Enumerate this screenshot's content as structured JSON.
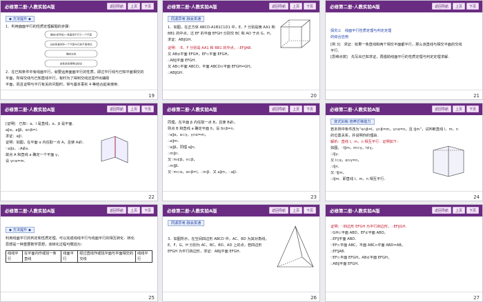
{
  "header": {
    "title": "必修第二册·人教实验A版",
    "btn_nav": "返回导航",
    "btn_prev": "上页",
    "btn_next": "下页"
  },
  "colors": {
    "header": "#6a2c82",
    "accent_red": "#c0182b",
    "accent_blue": "#1b3fa6"
  },
  "slides": [
    {
      "num": "19",
      "tip": "方法提升",
      "lines": [
        "1．利用面面平行的性质定理解题的步骤：",
        "2．在已知条件中有线面平行，就要运用面面平行的性质，即过平行线与已知平面相交的",
        "平面，所得交线与已知直线平行，有时为了得到交线还需作出辅助",
        "平面，而且证明与平行有关的问题时，常与基本事实 4 等结合起来使用．"
      ],
      "flow": [
        "确定(或寻找)一条直线平行于一个平面",
        "过这条直线作一个平面与已知平面相交",
        "确定交线",
        "由性质定理得出结论"
      ]
    },
    {
      "num": "20",
      "badge": "同源异考",
      "badge_sub": "融会贯通",
      "lines": [
        "1．如图，在正方体 ABCD-A1B1C1D1 中，E、F 分别是棱 AA1 和",
        "BB1 的中点，过 EF 的平面 EFGH 分别交 BC 和 AD 于点 G、H，",
        "求证：AB∥GH．",
        "证明：∵E、F 分别是 AA1 和 BB1 的中点，∴EF∥AB．",
        "又 AB⊄平面 EFGH，EF⊂平面 EFGH，",
        "∴AB∥平面 EFGH．",
        "又 AB⊂平面 ABCD，平面 ABCD∩平面 EFGH=GH，",
        "∴AB∥GH．"
      ]
    },
    {
      "num": "21",
      "lines": [
        "探究三　线面平行性质定理与判定定理",
        "的综合应用",
        "[例 3]　求证：如果一条直线和两个相交平面都平行，那么该直线与相交平面的交线",
        "平行．",
        "[思维点拨]　先写出已知求证，再借助线面平行的性质定理与判定定理求解．"
      ]
    },
    {
      "num": "22",
      "lines": [
        "[证明]　已知：a、l 是直线，α、β 是平面．",
        "a∥α，a∥β，α∩β=l．",
        "求证：a∥l．",
        "证明：如图，在平面 α 内任取一点 A，且使 A∉l．",
        "∵a∥α，∴A∉a．",
        "故点 A 和直线 a 确定一个平面 γ，",
        "设 γ∩α=m．"
      ]
    },
    {
      "num": "23",
      "lines": [
        "同理，在平面 β 内任取一点 B，且使 B∉l，",
        "则点 B 和直线 a 确定平面 δ，设 δ∩β=n．",
        "∵a∥α，a⊂γ，γ∩α=m，",
        "∴a∥m．",
        "∵a∥β，同理 a∥n．",
        "∴m∥n．",
        "又∵m⊄β，n⊂β，",
        "∴m∥β．",
        "又∵m⊂α，α∩β=l，∴m∥l．又 a∥m，∴a∥l．"
      ]
    },
    {
      "num": "24",
      "badge": "变式训练",
      "badge_sub": "培养迁移能力",
      "lines": [
        "若本例中条件改为“α∩β=l，γ∩β=m，γ∩α=n，且 l∥m”，试判断直线 l、m、n",
        "的位置关系，并说明你的理由．",
        "解析：直线 l、m、n 相互平行．证明如下：",
        "如图，∵l∥m，m⊂γ，l⊄γ，",
        "∴l∥γ．",
        "又 l⊂α，α∩γ=n，",
        "∴l∥n．",
        "又∵l∥m，",
        "∴l∥m．即直线 l、m、n 相互平行．"
      ]
    },
    {
      "num": "25",
      "tip": "方法提升",
      "lines": [
        "利用线面平行的判定和性质定理，可以完成线线平行与线面平行的相互转化．转化",
        "思想是一种重要数学思想，该转化过程可概括为："
      ],
      "table": [
        [
          "线线平行",
          "在平面内作或找一条直线",
          "线面平行",
          "经过直线作或找平面与平面相交的交线",
          "线线平行"
        ]
      ]
    },
    {
      "num": "26",
      "badge": "同源异考",
      "badge_sub": "融会贯通",
      "lines": [
        "3．如图所示，在空间四边形 ABCD 中，AC、BD 为其对角线，",
        "E、F、G、H 分别为 AC、BC、BD、AD 上的点，若四边形",
        "EFGH 为平行四边形，求证：AB∥平面 EFGH．"
      ]
    },
    {
      "num": "27",
      "lines": [
        "证明：∵四边形 EFGH 为平行四边形，∴EF∥GH．",
        "∵GH⊂平面 ABD，EF⊄平面 ABD，",
        "∴EF∥平面 ABD．",
        "∵EF⊂平面 ABC，平面 ABC∩平面 ABD=AB，",
        "∴EF∥AB．",
        "∵EF⊂平面 EFGH，AB⊄平面 EFGH，",
        "∴AB∥平面 EFGH．"
      ]
    }
  ]
}
